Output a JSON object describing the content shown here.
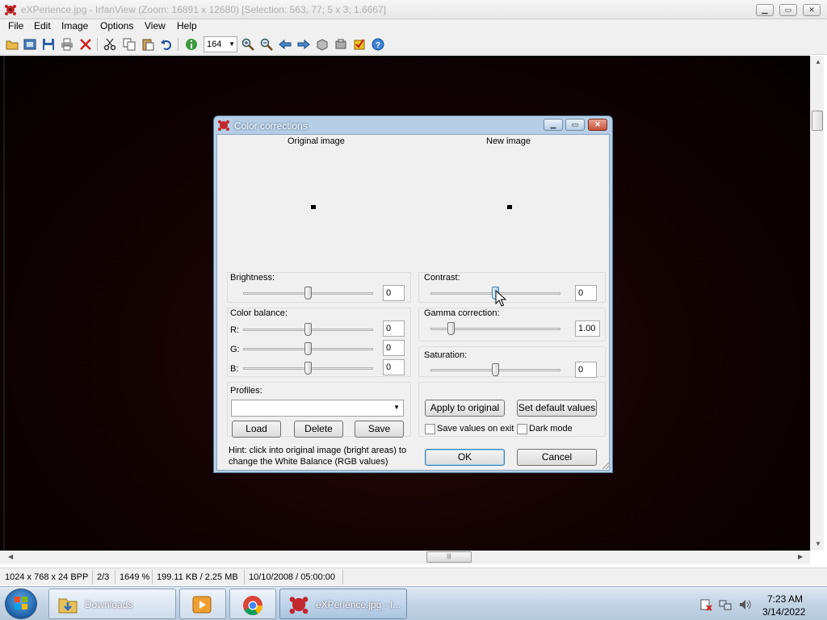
{
  "window": {
    "title": "eXPerience.jpg - IrfanView (Zoom: 16891 x 12680) [Selection: 563, 77; 5 x 3; 1.6667]"
  },
  "menu": [
    "File",
    "Edit",
    "Image",
    "Options",
    "View",
    "Help"
  ],
  "toolbar": {
    "zoom_value": "164"
  },
  "statusbar": {
    "dimensions": "1024 x 768 x 24 BPP",
    "index": "2/3",
    "zoom": "1649 %",
    "filesize": "199.11 KB / 2.25 MB",
    "datetime": "10/10/2008 / 05:00:00"
  },
  "dialog": {
    "title": "Color corrections",
    "original_label": "Original image",
    "new_label": "New image",
    "brightness": {
      "label": "Brightness:",
      "value": "0",
      "level": 0.5
    },
    "contrast": {
      "label": "Contrast:",
      "value": "0",
      "level": 0.5
    },
    "color_balance": {
      "label": "Color balance:",
      "r": {
        "label": "R:",
        "value": "0",
        "level": 0.5
      },
      "g": {
        "label": "G:",
        "value": "0",
        "level": 0.5
      },
      "b": {
        "label": "B:",
        "value": "0",
        "level": 0.5
      }
    },
    "gamma": {
      "label": "Gamma correction:",
      "value": "1.00",
      "level": 0.16
    },
    "saturation": {
      "label": "Saturation:",
      "value": "0",
      "level": 0.5
    },
    "profiles": {
      "label": "Profiles:",
      "selected": "",
      "load": "Load",
      "delete": "Delete",
      "save": "Save"
    },
    "apply_label": "Apply to original",
    "defaults_label": "Set default values",
    "save_on_exit_label": "Save values on exit",
    "dark_mode_label": "Dark mode",
    "hint_line1": "Hint: click into original image (bright areas) to",
    "hint_line2": "change the White Balance (RGB values)",
    "ok_label": "OK",
    "cancel_label": "Cancel"
  },
  "taskbar": {
    "items": [
      {
        "label": "Downloads",
        "icon": "folder-icon"
      },
      {
        "label": "",
        "icon": "media-player-icon"
      },
      {
        "label": "",
        "icon": "chrome-icon"
      },
      {
        "label": "eXPerience.jpg - I...",
        "icon": "irfanview-icon"
      }
    ],
    "time": "7:23 AM",
    "date": "3/14/2022"
  },
  "colors": {
    "dialog_frame": "#b6cfe6",
    "canvas": "#140303",
    "taskbar": "#c3d4e4"
  }
}
